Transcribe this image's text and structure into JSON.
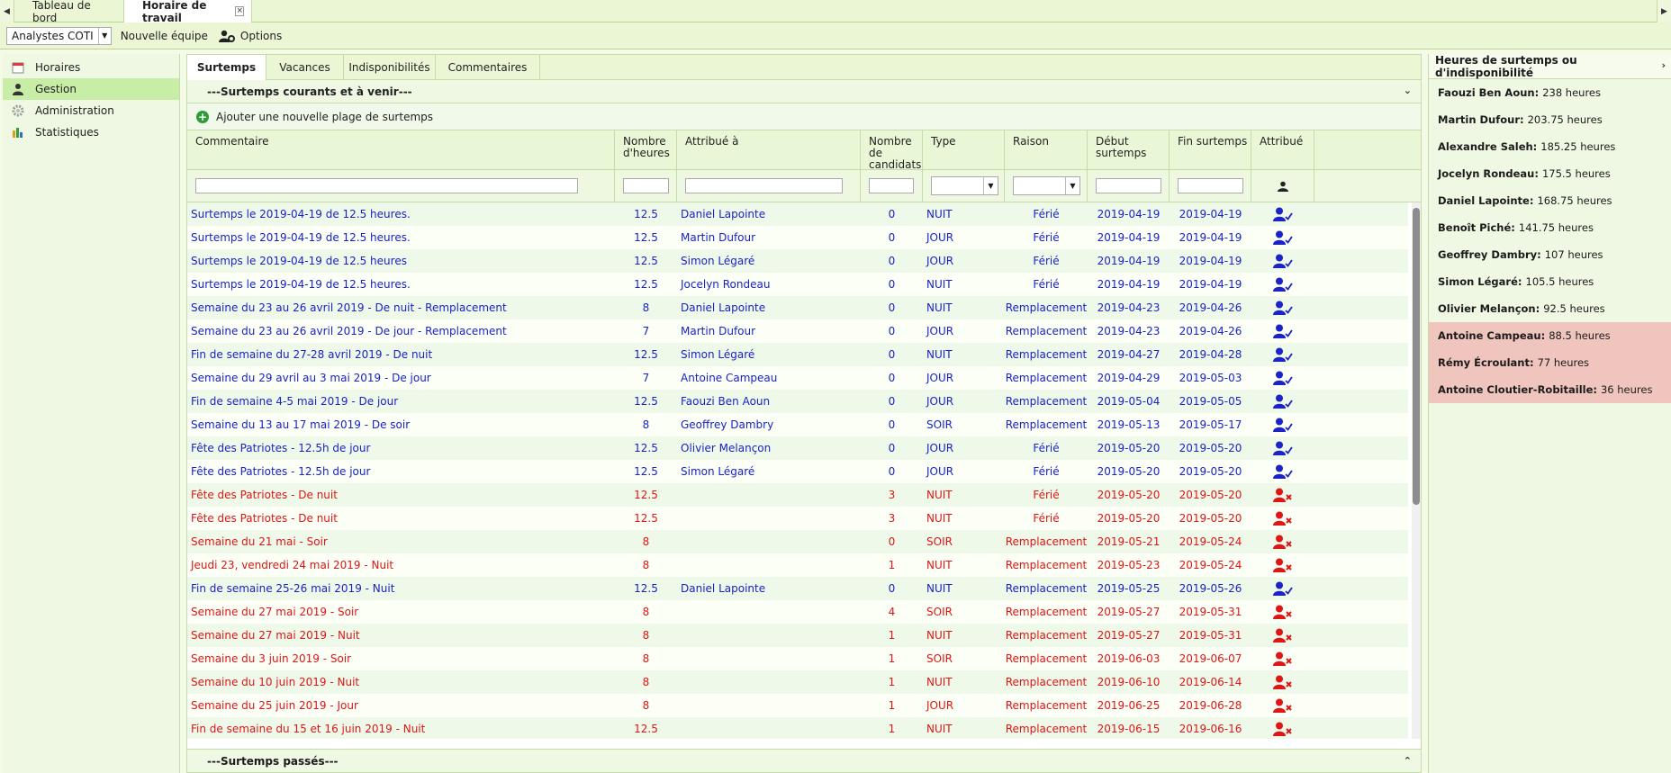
{
  "tabs": [
    {
      "label": "Tableau de bord",
      "active": false
    },
    {
      "label": "Horaire de travail",
      "active": true
    }
  ],
  "toolbar": {
    "team_select": "Analystes COTI",
    "new_team_label": "Nouvelle équipe",
    "options_label": "Options"
  },
  "sidebar": {
    "items": [
      {
        "label": "Horaires",
        "icon": "calendar-icon",
        "active": false
      },
      {
        "label": "Gestion",
        "icon": "user-icon",
        "active": true
      },
      {
        "label": "Administration",
        "icon": "gear-icon",
        "active": false
      },
      {
        "label": "Statistiques",
        "icon": "bar-chart-icon",
        "active": false
      }
    ]
  },
  "subtabs": [
    "Surtemps",
    "Vacances",
    "Indisponibilités",
    "Commentaires"
  ],
  "sections": {
    "current": "---Surtemps courants et à venir---",
    "add_label": "Ajouter une nouvelle plage de surtemps",
    "past": "---Surtemps passés---"
  },
  "table": {
    "headers": [
      "Commentaire",
      "Nombre d'heures",
      "Attribué à",
      "Nombre de candidats",
      "Type",
      "Raison",
      "Début surtemps",
      "Fin surtemps",
      "Attribué"
    ],
    "rows": [
      {
        "comment": "Surtemps le 2019-04-19 de 12.5 heures.",
        "hours": "12.5",
        "assigned": "Daniel Lapointe",
        "candidates": "0",
        "type": "NUIT",
        "reason": "Férié",
        "start": "2019-04-19",
        "end": "2019-04-19",
        "status": "assigned"
      },
      {
        "comment": "Surtemps le 2019-04-19 de 12.5 heures.",
        "hours": "12.5",
        "assigned": "Martin Dufour",
        "candidates": "0",
        "type": "JOUR",
        "reason": "Férié",
        "start": "2019-04-19",
        "end": "2019-04-19",
        "status": "assigned"
      },
      {
        "comment": "Surtemps le 2019-04-19 de 12.5 heures",
        "hours": "12.5",
        "assigned": "Simon Légaré",
        "candidates": "0",
        "type": "JOUR",
        "reason": "Férié",
        "start": "2019-04-19",
        "end": "2019-04-19",
        "status": "assigned"
      },
      {
        "comment": "Surtemps le 2019-04-19 de 12.5 heures.",
        "hours": "12.5",
        "assigned": "Jocelyn Rondeau",
        "candidates": "0",
        "type": "NUIT",
        "reason": "Férié",
        "start": "2019-04-19",
        "end": "2019-04-19",
        "status": "assigned"
      },
      {
        "comment": "Semaine du 23 au 26 avril 2019 - De nuit - Remplacement",
        "hours": "8",
        "assigned": "Daniel Lapointe",
        "candidates": "0",
        "type": "NUIT",
        "reason": "Remplacement",
        "start": "2019-04-23",
        "end": "2019-04-26",
        "status": "assigned"
      },
      {
        "comment": "Semaine du 23 au 26 avril 2019 - De jour - Remplacement",
        "hours": "7",
        "assigned": "Martin Dufour",
        "candidates": "0",
        "type": "JOUR",
        "reason": "Remplacement",
        "start": "2019-04-23",
        "end": "2019-04-26",
        "status": "assigned"
      },
      {
        "comment": "Fin de semaine du 27-28 avril 2019 - De nuit",
        "hours": "12.5",
        "assigned": "Simon Légaré",
        "candidates": "0",
        "type": "NUIT",
        "reason": "Remplacement",
        "start": "2019-04-27",
        "end": "2019-04-28",
        "status": "assigned"
      },
      {
        "comment": "Semaine du 29 avril au 3 mai 2019 - De jour",
        "hours": "7",
        "assigned": "Antoine Campeau",
        "candidates": "0",
        "type": "JOUR",
        "reason": "Remplacement",
        "start": "2019-04-29",
        "end": "2019-05-03",
        "status": "assigned"
      },
      {
        "comment": "Fin de semaine 4-5 mai 2019 - De jour",
        "hours": "12.5",
        "assigned": "Faouzi Ben Aoun",
        "candidates": "0",
        "type": "JOUR",
        "reason": "Remplacement",
        "start": "2019-05-04",
        "end": "2019-05-05",
        "status": "assigned"
      },
      {
        "comment": "Semaine du 13 au 17 mai 2019 - De soir",
        "hours": "8",
        "assigned": "Geoffrey Dambry",
        "candidates": "0",
        "type": "SOIR",
        "reason": "Remplacement",
        "start": "2019-05-13",
        "end": "2019-05-17",
        "status": "assigned"
      },
      {
        "comment": "Fête des Patriotes - 12.5h de jour",
        "hours": "12.5",
        "assigned": "Olivier Melançon",
        "candidates": "0",
        "type": "JOUR",
        "reason": "Férié",
        "start": "2019-05-20",
        "end": "2019-05-20",
        "status": "assigned"
      },
      {
        "comment": "Fête des Patriotes - 12.5h de jour",
        "hours": "12.5",
        "assigned": "Simon Légaré",
        "candidates": "0",
        "type": "JOUR",
        "reason": "Férié",
        "start": "2019-05-20",
        "end": "2019-05-20",
        "status": "assigned"
      },
      {
        "comment": "Fête des Patriotes - De nuit",
        "hours": "12.5",
        "assigned": "",
        "candidates": "3",
        "type": "NUIT",
        "reason": "Férié",
        "start": "2019-05-20",
        "end": "2019-05-20",
        "status": "unassigned"
      },
      {
        "comment": "Fête des Patriotes - De nuit",
        "hours": "12.5",
        "assigned": "",
        "candidates": "3",
        "type": "NUIT",
        "reason": "Férié",
        "start": "2019-05-20",
        "end": "2019-05-20",
        "status": "unassigned"
      },
      {
        "comment": "Semaine du 21 mai - Soir",
        "hours": "8",
        "assigned": "",
        "candidates": "0",
        "type": "SOIR",
        "reason": "Remplacement",
        "start": "2019-05-21",
        "end": "2019-05-24",
        "status": "unassigned"
      },
      {
        "comment": "Jeudi 23, vendredi 24 mai 2019 - Nuit",
        "hours": "8",
        "assigned": "",
        "candidates": "1",
        "type": "NUIT",
        "reason": "Remplacement",
        "start": "2019-05-23",
        "end": "2019-05-24",
        "status": "unassigned"
      },
      {
        "comment": "Fin de semaine 25-26 mai 2019 - Nuit",
        "hours": "12.5",
        "assigned": "Daniel Lapointe",
        "candidates": "0",
        "type": "NUIT",
        "reason": "Remplacement",
        "start": "2019-05-25",
        "end": "2019-05-26",
        "status": "assigned"
      },
      {
        "comment": "Semaine du 27 mai 2019 - Soir",
        "hours": "8",
        "assigned": "",
        "candidates": "4",
        "type": "SOIR",
        "reason": "Remplacement",
        "start": "2019-05-27",
        "end": "2019-05-31",
        "status": "unassigned"
      },
      {
        "comment": "Semaine du 27 mai 2019 - Nuit",
        "hours": "8",
        "assigned": "",
        "candidates": "1",
        "type": "NUIT",
        "reason": "Remplacement",
        "start": "2019-05-27",
        "end": "2019-05-31",
        "status": "unassigned"
      },
      {
        "comment": "Semaine du 3 juin 2019 - Soir",
        "hours": "8",
        "assigned": "",
        "candidates": "1",
        "type": "SOIR",
        "reason": "Remplacement",
        "start": "2019-06-03",
        "end": "2019-06-07",
        "status": "unassigned"
      },
      {
        "comment": "Semaine du 10 juin 2019 - Nuit",
        "hours": "8",
        "assigned": "",
        "candidates": "1",
        "type": "NUIT",
        "reason": "Remplacement",
        "start": "2019-06-10",
        "end": "2019-06-14",
        "status": "unassigned"
      },
      {
        "comment": "Semaine du 25 juin 2019 - Jour",
        "hours": "8",
        "assigned": "",
        "candidates": "1",
        "type": "JOUR",
        "reason": "Remplacement",
        "start": "2019-06-25",
        "end": "2019-06-28",
        "status": "unassigned"
      },
      {
        "comment": "Fin de semaine du 15 et 16 juin 2019 - Nuit",
        "hours": "12.5",
        "assigned": "",
        "candidates": "1",
        "type": "NUIT",
        "reason": "Remplacement",
        "start": "2019-06-15",
        "end": "2019-06-16",
        "status": "unassigned"
      }
    ]
  },
  "right_panel": {
    "title": "Heures de surtemps ou d'indisponibilité",
    "employees": [
      {
        "name": "Faouzi Ben Aoun:",
        "hours": "238 heures",
        "warn": false
      },
      {
        "name": "Martin Dufour:",
        "hours": "203.75 heures",
        "warn": false
      },
      {
        "name": "Alexandre Saleh:",
        "hours": "185.25 heures",
        "warn": false
      },
      {
        "name": "Jocelyn Rondeau:",
        "hours": "175.5 heures",
        "warn": false
      },
      {
        "name": "Daniel Lapointe:",
        "hours": "168.75 heures",
        "warn": false
      },
      {
        "name": "Benoît Piché:",
        "hours": "141.75 heures",
        "warn": false
      },
      {
        "name": "Geoffrey Dambry:",
        "hours": "107 heures",
        "warn": false
      },
      {
        "name": "Simon Légaré:",
        "hours": "105.5 heures",
        "warn": false
      },
      {
        "name": "Olivier Melançon:",
        "hours": "92.5 heures",
        "warn": false
      },
      {
        "name": "Antoine Campeau:",
        "hours": "88.5 heures",
        "warn": true
      },
      {
        "name": "Rémy Écroulant:",
        "hours": "77 heures",
        "warn": true
      },
      {
        "name": "Antoine Cloutier-Robitaille:",
        "hours": "36 heures",
        "warn": true
      }
    ]
  },
  "colors": {
    "assigned": "#1a22c8",
    "unassigned": "#e01515",
    "warn_bg": "#efc5be"
  }
}
